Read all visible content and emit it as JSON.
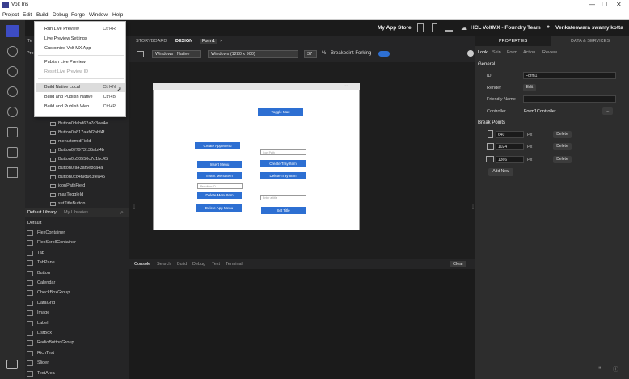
{
  "window": {
    "title": "Volt Iris"
  },
  "menu": [
    "Project",
    "Edit",
    "Build",
    "Debug",
    "Forge",
    "Window",
    "Help"
  ],
  "build_menu": [
    {
      "label": "Run Live Preview",
      "shortcut": "Ctrl+R"
    },
    {
      "label": "Live Preview Settings",
      "shortcut": ""
    },
    {
      "label": "Customize Volt MX App",
      "shortcut": ""
    },
    {
      "label": "Publish Live Preview",
      "shortcut": ""
    },
    {
      "label": "Reset Live Preview ID",
      "shortcut": ""
    },
    {
      "label": "Build Native Local",
      "shortcut": "Ctrl+N"
    },
    {
      "label": "Build and Publish Native",
      "shortcut": "Ctrl+B"
    },
    {
      "label": "Build and Publish Web",
      "shortcut": "Ctrl+P"
    }
  ],
  "topbar": {
    "store": "My App Store",
    "team": "HCL VoltMX - Foundry Team",
    "user": "Venkateswara swamy kotta"
  },
  "tabs": {
    "left_partial": "Te",
    "storyboard": "STORYBOARD",
    "design": "DESIGN",
    "form": "Form1",
    "close": "×"
  },
  "toolbar": {
    "device": "Windows : Native",
    "resolution": "Windows (1280 x 900)",
    "zoom": "37",
    "zoom_unit": "%",
    "breakpoint": "Breakpoint Forking"
  },
  "left_tree_header": "Pro",
  "tree": [
    "Button0dabd62a7c3ee4e",
    "Button0a817aafd2abf4f",
    "menuitemidField",
    "Button0jf7973135abf4b",
    "Button0b50550c7d1bc45",
    "Button0fa43af5e8ca4a",
    "Button0cd4f9d9c3fea45",
    "iconPathField",
    "maxToggleId",
    "setTitleButton"
  ],
  "library": {
    "tab_default": "Default Library",
    "tab_mine": "My Libraries",
    "group": "Default",
    "items": [
      "FlexContainer",
      "FlexScrollContainer",
      "Tab",
      "TabPane",
      "Button",
      "Calendar",
      "CheckBoxGroup",
      "DataGrid",
      "Image",
      "Label",
      "ListBox",
      "RadioButtonGroup",
      "RichText",
      "Slider",
      "TextArea"
    ]
  },
  "form": {
    "toggle_max": "Toggle Max",
    "create_app_menu": "Create App Menu",
    "insert_menu": "Insert Menu",
    "insert_menuitem": "Insert MenuItem",
    "menuitem_id_placeholder": "Menuitem ID",
    "delete_menuitem": "Delete MenuItem",
    "delete_app_menu": "Delete App Menu",
    "icon_path_placeholder": "Icon Path",
    "create_tray_item": "Create Tray Item",
    "delete_tray_item": "Delete Tray Item",
    "title_placeholder": "Enter a title",
    "set_title": "Set Title"
  },
  "console_tabs": [
    "Console",
    "Search",
    "Build",
    "Debug",
    "Text",
    "Terminal"
  ],
  "console_clear": "Clear",
  "right": {
    "tab_properties": "PROPERTIES",
    "tab_data": "DATA & SERVICES",
    "subtabs": [
      "Look",
      "Skin",
      "Form",
      "Action",
      "Review"
    ],
    "general": "General",
    "id_label": "ID",
    "id_value": "Form1",
    "render_label": "Render",
    "render_btn": "Edit",
    "friendly_label": "Friendly Name",
    "controller_label": "Controller",
    "controller_value": "Form1Controller",
    "controller_btn": "...",
    "breakpoints": "Break Points",
    "bp": [
      {
        "value": "640",
        "unit": "Px",
        "btn": "Delete"
      },
      {
        "value": "1024",
        "unit": "Px",
        "btn": "Delete"
      },
      {
        "value": "1366",
        "unit": "Px",
        "btn": "Delete"
      }
    ],
    "add_new": "Add New"
  }
}
